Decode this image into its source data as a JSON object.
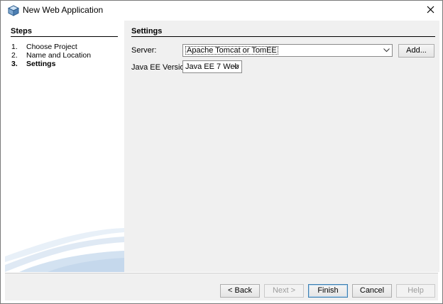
{
  "window": {
    "title": "New Web Application"
  },
  "steps": {
    "heading": "Steps",
    "items": [
      {
        "num": "1.",
        "label": "Choose Project"
      },
      {
        "num": "2.",
        "label": "Name and Location"
      },
      {
        "num": "3.",
        "label": "Settings",
        "current": true
      }
    ]
  },
  "settings": {
    "heading": "Settings",
    "server_label": "Server:",
    "server_value": "Apache Tomcat or TomEE",
    "add_button": "Add...",
    "javaee_label": "Java EE Version:",
    "javaee_value": "Java EE 7 Web"
  },
  "footer": {
    "back": "< Back",
    "next": "Next >",
    "finish": "Finish",
    "cancel": "Cancel",
    "help": "Help"
  },
  "icons": {
    "app": "netbeans-cube-icon",
    "close": "close-icon",
    "dropdown": "chevron-down-icon"
  },
  "colors": {
    "panel_bg": "#f0f0f0",
    "default_button_border": "#3c7fb1",
    "swoosh": "#b8d0e8"
  }
}
